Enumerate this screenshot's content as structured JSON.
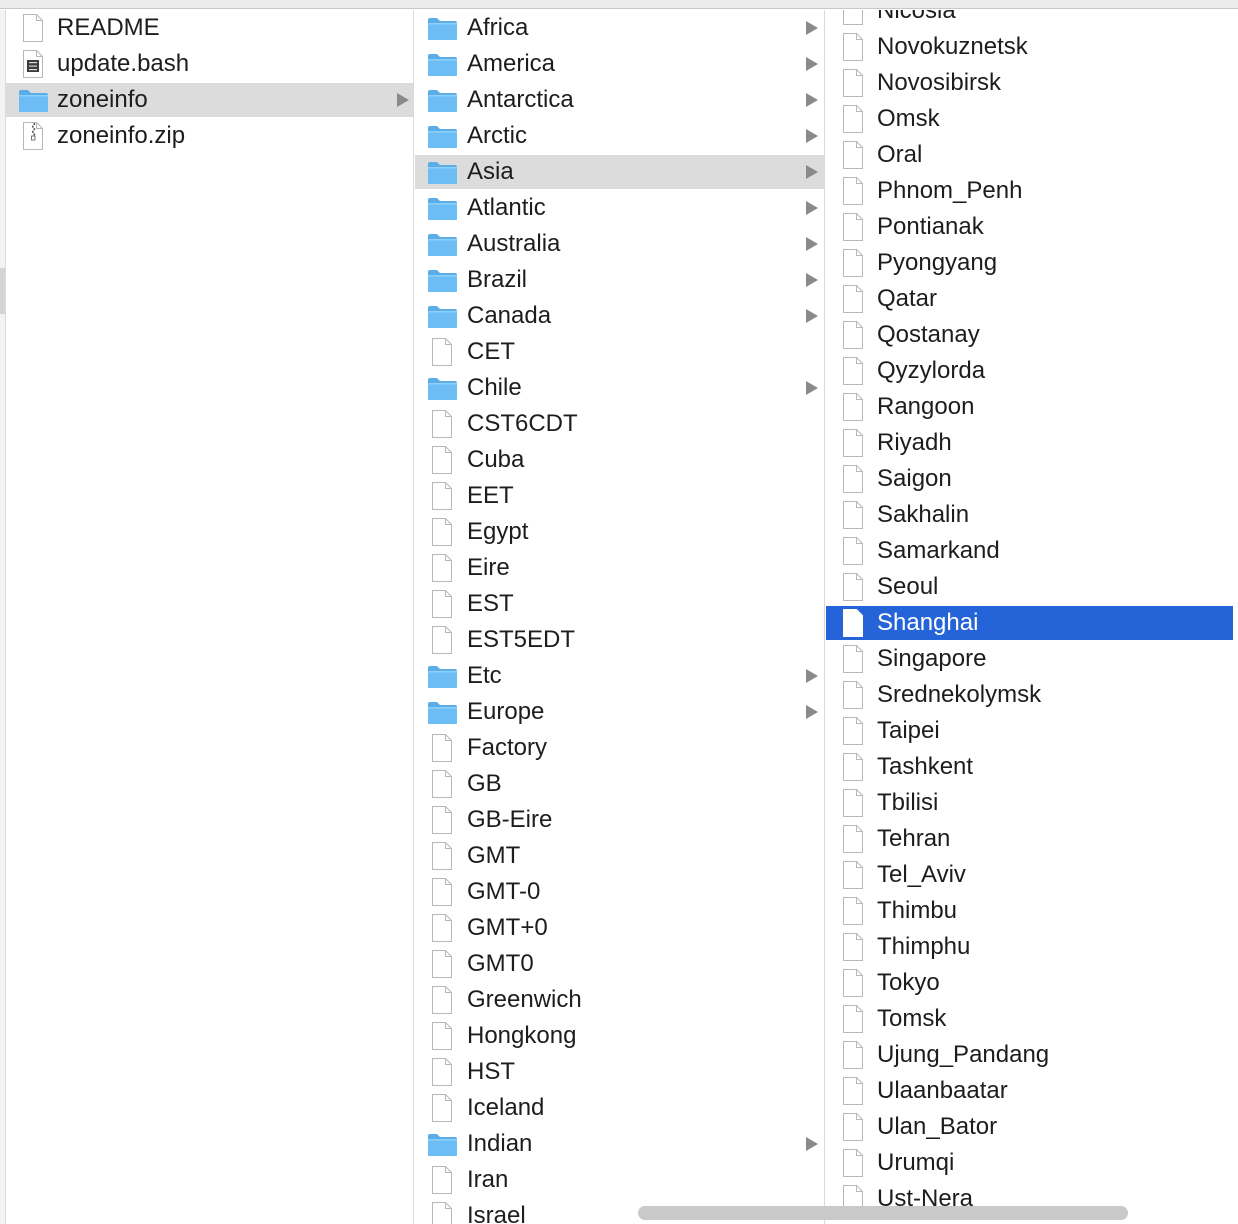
{
  "column1": {
    "items": [
      {
        "label": "README",
        "type": "document",
        "has_children": false,
        "selected": false
      },
      {
        "label": "update.bash",
        "type": "script",
        "has_children": false,
        "selected": false
      },
      {
        "label": "zoneinfo",
        "type": "folder",
        "has_children": true,
        "selected": true
      },
      {
        "label": "zoneinfo.zip",
        "type": "archive",
        "has_children": false,
        "selected": false
      }
    ]
  },
  "column2": {
    "items": [
      {
        "label": "Africa",
        "type": "folder",
        "has_children": true
      },
      {
        "label": "America",
        "type": "folder",
        "has_children": true
      },
      {
        "label": "Antarctica",
        "type": "folder",
        "has_children": true
      },
      {
        "label": "Arctic",
        "type": "folder",
        "has_children": true
      },
      {
        "label": "Asia",
        "type": "folder",
        "has_children": true,
        "selected": true
      },
      {
        "label": "Atlantic",
        "type": "folder",
        "has_children": true
      },
      {
        "label": "Australia",
        "type": "folder",
        "has_children": true
      },
      {
        "label": "Brazil",
        "type": "folder",
        "has_children": true
      },
      {
        "label": "Canada",
        "type": "folder",
        "has_children": true
      },
      {
        "label": "CET",
        "type": "document",
        "has_children": false
      },
      {
        "label": "Chile",
        "type": "folder",
        "has_children": true
      },
      {
        "label": "CST6CDT",
        "type": "document",
        "has_children": false
      },
      {
        "label": "Cuba",
        "type": "document",
        "has_children": false
      },
      {
        "label": "EET",
        "type": "document",
        "has_children": false
      },
      {
        "label": "Egypt",
        "type": "document",
        "has_children": false
      },
      {
        "label": "Eire",
        "type": "document",
        "has_children": false
      },
      {
        "label": "EST",
        "type": "document",
        "has_children": false
      },
      {
        "label": "EST5EDT",
        "type": "document",
        "has_children": false
      },
      {
        "label": "Etc",
        "type": "folder",
        "has_children": true
      },
      {
        "label": "Europe",
        "type": "folder",
        "has_children": true
      },
      {
        "label": "Factory",
        "type": "document",
        "has_children": false
      },
      {
        "label": "GB",
        "type": "document",
        "has_children": false
      },
      {
        "label": "GB-Eire",
        "type": "document",
        "has_children": false
      },
      {
        "label": "GMT",
        "type": "document",
        "has_children": false
      },
      {
        "label": "GMT-0",
        "type": "document",
        "has_children": false
      },
      {
        "label": "GMT+0",
        "type": "document",
        "has_children": false
      },
      {
        "label": "GMT0",
        "type": "document",
        "has_children": false
      },
      {
        "label": "Greenwich",
        "type": "document",
        "has_children": false
      },
      {
        "label": "Hongkong",
        "type": "document",
        "has_children": false
      },
      {
        "label": "HST",
        "type": "document",
        "has_children": false
      },
      {
        "label": "Iceland",
        "type": "document",
        "has_children": false
      },
      {
        "label": "Indian",
        "type": "folder",
        "has_children": true
      },
      {
        "label": "Iran",
        "type": "document",
        "has_children": false
      },
      {
        "label": "Israel",
        "type": "document",
        "has_children": false
      }
    ]
  },
  "column3": {
    "items": [
      {
        "label": "Nicosia",
        "type": "document"
      },
      {
        "label": "Novokuznetsk",
        "type": "document"
      },
      {
        "label": "Novosibirsk",
        "type": "document"
      },
      {
        "label": "Omsk",
        "type": "document"
      },
      {
        "label": "Oral",
        "type": "document"
      },
      {
        "label": "Phnom_Penh",
        "type": "document"
      },
      {
        "label": "Pontianak",
        "type": "document"
      },
      {
        "label": "Pyongyang",
        "type": "document"
      },
      {
        "label": "Qatar",
        "type": "document"
      },
      {
        "label": "Qostanay",
        "type": "document"
      },
      {
        "label": "Qyzylorda",
        "type": "document"
      },
      {
        "label": "Rangoon",
        "type": "document"
      },
      {
        "label": "Riyadh",
        "type": "document"
      },
      {
        "label": "Saigon",
        "type": "document"
      },
      {
        "label": "Sakhalin",
        "type": "document"
      },
      {
        "label": "Samarkand",
        "type": "document"
      },
      {
        "label": "Seoul",
        "type": "document"
      },
      {
        "label": "Shanghai",
        "type": "document",
        "selected": true
      },
      {
        "label": "Singapore",
        "type": "document"
      },
      {
        "label": "Srednekolymsk",
        "type": "document"
      },
      {
        "label": "Taipei",
        "type": "document"
      },
      {
        "label": "Tashkent",
        "type": "document"
      },
      {
        "label": "Tbilisi",
        "type": "document"
      },
      {
        "label": "Tehran",
        "type": "document"
      },
      {
        "label": "Tel_Aviv",
        "type": "document"
      },
      {
        "label": "Thimbu",
        "type": "document"
      },
      {
        "label": "Thimphu",
        "type": "document"
      },
      {
        "label": "Tokyo",
        "type": "document"
      },
      {
        "label": "Tomsk",
        "type": "document"
      },
      {
        "label": "Ujung_Pandang",
        "type": "document"
      },
      {
        "label": "Ulaanbaatar",
        "type": "document"
      },
      {
        "label": "Ulan_Bator",
        "type": "document"
      },
      {
        "label": "Urumqi",
        "type": "document"
      },
      {
        "label": "Ust-Nera",
        "type": "document"
      }
    ]
  },
  "colors": {
    "selection_active": "#2563d9",
    "selection_inactive": "#dcdcdc",
    "folder": "#6cbdf5",
    "disclosure_arrow": "#8a8a8a"
  }
}
